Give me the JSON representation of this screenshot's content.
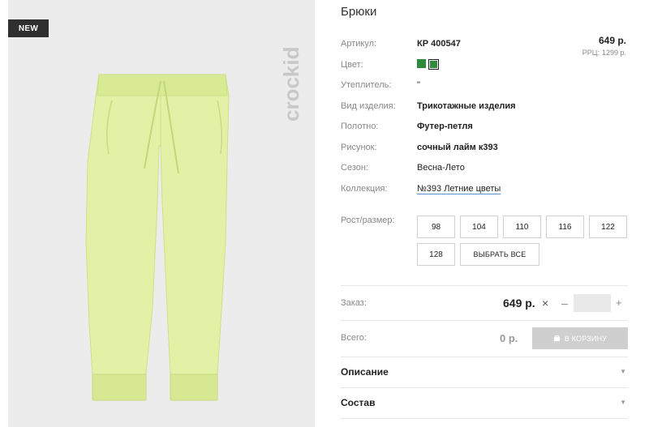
{
  "badge": "NEW",
  "brand": "crockid",
  "product": {
    "title": "Брюки",
    "attributes": [
      {
        "label": "Артикул:",
        "value": "КР 400547"
      },
      {
        "label": "Цвет:",
        "value": ""
      },
      {
        "label": "Утеплитель:",
        "value": "\""
      },
      {
        "label": "Вид изделия:",
        "value": "Трикотажные изделия"
      },
      {
        "label": "Полотно:",
        "value": "Футер-петля"
      },
      {
        "label": "Рисунок:",
        "value": "сочный лайм к393"
      },
      {
        "label": "Сезон:",
        "value": "Весна-Лето"
      },
      {
        "label": "Коллекция:",
        "value": "№393 Летние цветы"
      }
    ],
    "price": "649 р.",
    "rrc_label": "РРЦ:",
    "rrc_value": "1299 р.",
    "swatch_colors": [
      "#2f8a3c",
      "#2f8a3c"
    ]
  },
  "sizes": {
    "label": "Рост/размер:",
    "options": [
      "98",
      "104",
      "110",
      "116",
      "122",
      "128"
    ],
    "select_all": "ВЫБРАТЬ ВСЕ"
  },
  "order": {
    "label": "Заказ:",
    "price": "649 р.",
    "times": "×",
    "minus": "–",
    "plus": "+",
    "quantity": ""
  },
  "total": {
    "label": "Всего:",
    "value": "0 р.",
    "cart_button": "В КОРЗИНУ"
  },
  "accordions": [
    {
      "title": "Описание"
    },
    {
      "title": "Состав"
    }
  ],
  "colors": {
    "product": "#e3f1a6",
    "product_shadow": "#cfe08a",
    "panel_bg": "#ececec"
  }
}
